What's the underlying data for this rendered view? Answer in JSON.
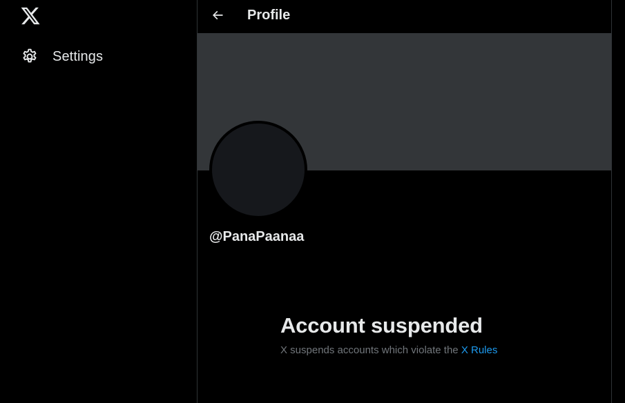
{
  "sidebar": {
    "logo_icon": "x-logo-icon",
    "items": [
      {
        "icon": "gear-icon",
        "label": "Settings"
      }
    ]
  },
  "header": {
    "back_icon": "arrow-left-icon",
    "title": "Profile"
  },
  "profile": {
    "handle": "@PanaPaanaa",
    "banner_color": "#333639",
    "avatar_color": "#16181c"
  },
  "suspension": {
    "title": "Account suspended",
    "message": "X suspends accounts which violate the",
    "link_label": "X Rules"
  },
  "colors": {
    "background": "#000000",
    "text_primary": "#e7e9ea",
    "text_secondary": "#71767b",
    "link": "#1d9bf0",
    "border": "#2f3336"
  }
}
